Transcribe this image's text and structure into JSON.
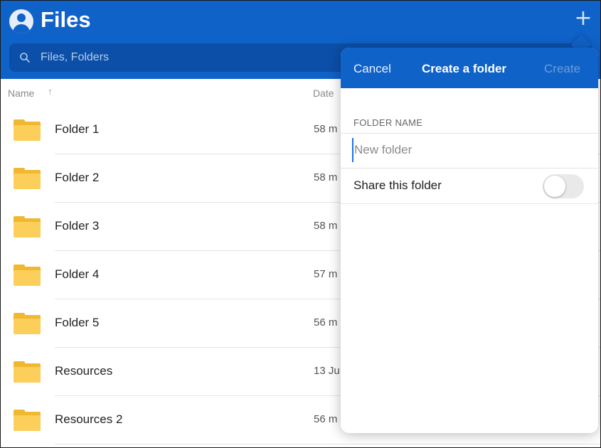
{
  "app": {
    "title": "Files",
    "add_icon": "plus-icon",
    "avatar_icon": "user-avatar-icon"
  },
  "search": {
    "placeholder": "Files, Folders",
    "icon": "search-icon"
  },
  "list": {
    "header_name": "Name",
    "sort_indicator": "↑",
    "header_date": "Date",
    "items": [
      {
        "name": "Folder 1",
        "date": "58 m"
      },
      {
        "name": "Folder 2",
        "date": "58 m"
      },
      {
        "name": "Folder 3",
        "date": "58 m"
      },
      {
        "name": "Folder 4",
        "date": "57 m"
      },
      {
        "name": "Folder 5",
        "date": "56 m"
      },
      {
        "name": "Resources",
        "date": "13 Ju"
      },
      {
        "name": "Resources 2",
        "date": "56 m"
      }
    ]
  },
  "dialog": {
    "cancel_label": "Cancel",
    "title": "Create a folder",
    "create_label": "Create",
    "section_label": "FOLDER NAME",
    "folder_name_value": "",
    "folder_name_placeholder": "New folder",
    "share_label": "Share this folder",
    "share_enabled": false
  },
  "colors": {
    "brand": "#0f62c8",
    "folder": "#fccf5a"
  }
}
